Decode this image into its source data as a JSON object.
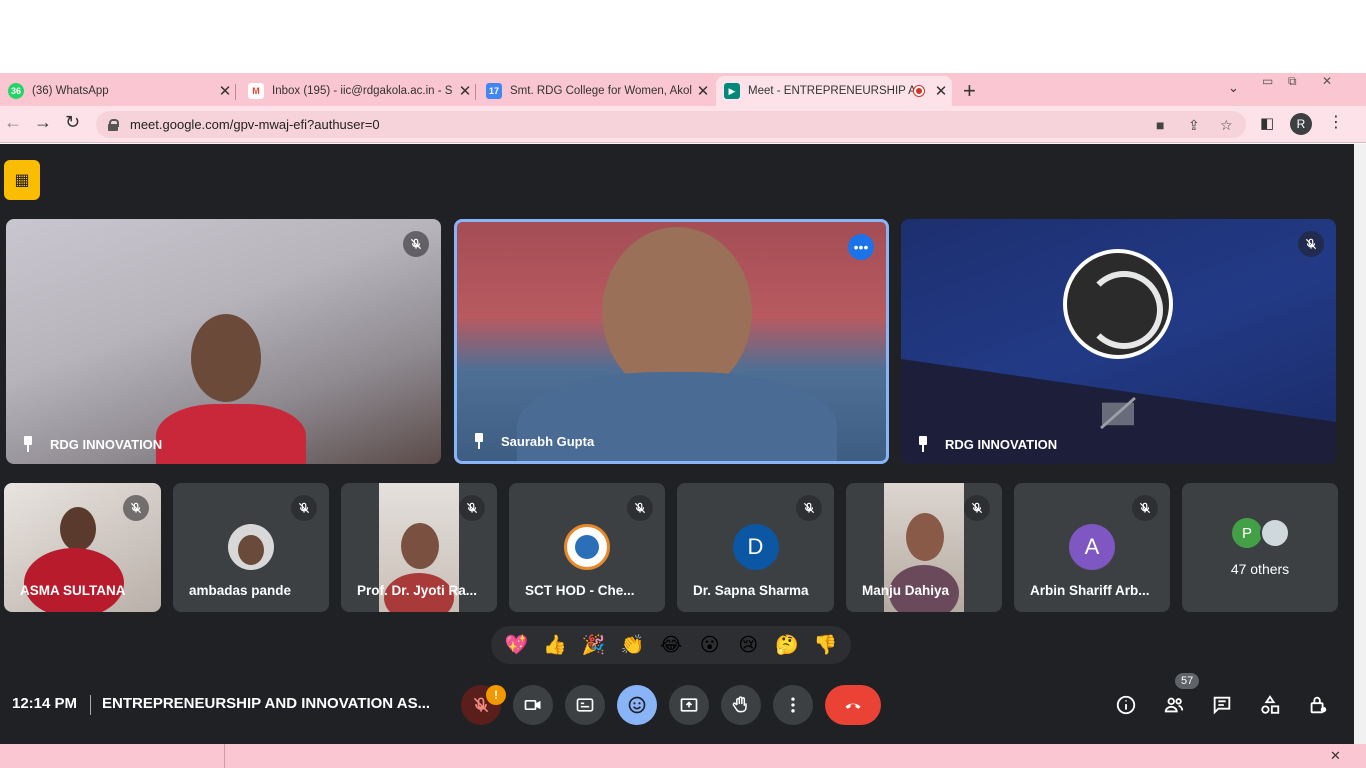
{
  "browser": {
    "tabs": [
      {
        "title": "(36) WhatsApp",
        "icon": "whatsapp-icon",
        "icon_text": "36",
        "color": "#25d366"
      },
      {
        "title": "Inbox (195) - iic@rdgakola.ac.in - S",
        "icon": "gmail-icon",
        "icon_text": "M",
        "color": "#ea4335"
      },
      {
        "title": "Smt. RDG College for Women, Akola",
        "icon": "calendar-icon",
        "icon_text": "17",
        "color": "#4285f4"
      },
      {
        "title": "Meet - ENTREPRENEURSHIP A",
        "icon": "meet-icon",
        "icon_text": "▶",
        "color": "#00897b"
      }
    ],
    "new_tab": "+",
    "url": "meet.google.com/gpv-mwaj-efi?authuser=0",
    "profile_initial": "R"
  },
  "main_tiles": [
    {
      "name": "RDG INNOVATION"
    },
    {
      "name": "Saurabh Gupta"
    },
    {
      "name": "RDG INNOVATION"
    }
  ],
  "small_tiles": [
    {
      "name": "ASMA SULTANA"
    },
    {
      "name": "ambadas pande"
    },
    {
      "name": "Prof. Dr. Jyoti Ra..."
    },
    {
      "name": "SCT HOD - Che..."
    },
    {
      "name": "Dr. Sapna Sharma",
      "initial": "D"
    },
    {
      "name": "Manju Dahiya"
    },
    {
      "name": "Arbin Shariff Arb...",
      "initial": "A"
    }
  ],
  "others": {
    "label": "47 others",
    "initial": "P"
  },
  "reactions": [
    "💖",
    "👍",
    "🎉",
    "👏",
    "😂",
    "😮",
    "😢",
    "🤔",
    "👎"
  ],
  "meeting": {
    "time": "12:14 PM",
    "title": "ENTREPRENEURSHIP AND INNOVATION AS...",
    "participant_count": "57",
    "warning": "!"
  },
  "colors": {
    "meet_bg": "#202124",
    "tile_bg": "#3c4043",
    "end_call": "#ea4335",
    "accent": "#8ab4f8",
    "tab_bar": "#f9c6d1"
  }
}
